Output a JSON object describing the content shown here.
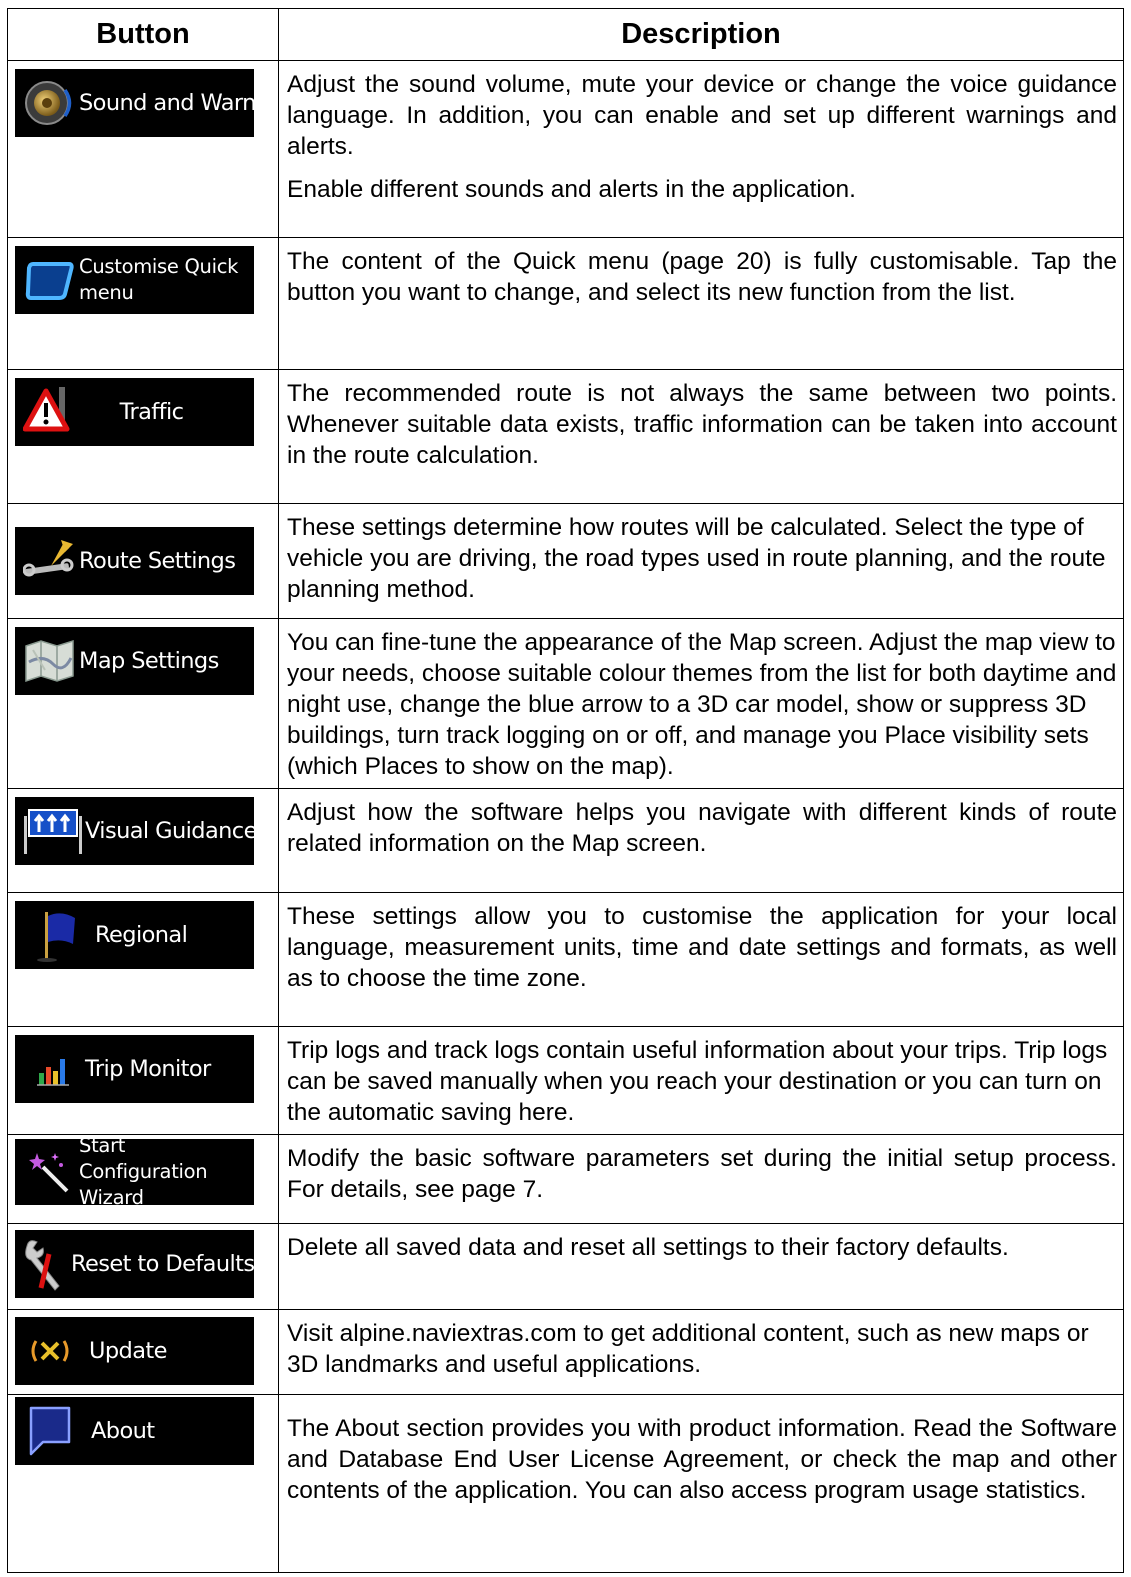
{
  "header": {
    "button": "Button",
    "description": "Description"
  },
  "rows": [
    {
      "label": "Sound and Warnings",
      "icon": "speaker-icon",
      "paragraphs": [
        "Adjust the sound volume, mute your device or change the voice guidance language. In addition, you can enable and set up different warnings and alerts.",
        "Enable different sounds and alerts in the application."
      ]
    },
    {
      "label": "Customise Quick menu",
      "icon": "quick-menu-icon",
      "paragraphs": [
        "The content of the Quick menu (page 20) is fully customisable. Tap the button you want to change, and select its new function from the list."
      ]
    },
    {
      "label": "Traffic",
      "icon": "traffic-warning-icon",
      "paragraphs": [
        "The recommended route is not always the same between two points. Whenever suitable data exists, traffic information can be taken into account in the route calculation."
      ]
    },
    {
      "label": "Route Settings",
      "icon": "route-settings-icon",
      "paragraphs": [
        "These settings determine how routes will be calculated. Select the type of vehicle you are driving, the road types used in route planning, and the route planning method."
      ]
    },
    {
      "label": "Map Settings",
      "icon": "map-icon",
      "paragraphs": [
        "You can fine-tune the appearance of the Map screen. Adjust the map view to your needs, choose suitable colour themes from the list for both daytime and night use, change the blue arrow to a 3D car model, show or suppress 3D buildings, turn track logging on or off, and manage you Place visibility sets (which Places to show on the map)."
      ]
    },
    {
      "label": "Visual Guidance",
      "icon": "lane-sign-icon",
      "paragraphs": [
        "Adjust how the software helps you navigate with different kinds of route related information on the Map screen."
      ]
    },
    {
      "label": "Regional",
      "icon": "flag-icon",
      "paragraphs": [
        "These settings allow you to customise the application for your local language, measurement units, time and date settings and formats, as well as to choose the time zone."
      ]
    },
    {
      "label": "Trip Monitor",
      "icon": "bar-chart-icon",
      "paragraphs": [
        "Trip logs and track logs contain useful information about your trips. Trip logs can be saved manually when you reach your destination or you can turn on the automatic saving here."
      ]
    },
    {
      "label": "Start Configuration Wizard",
      "icon": "magic-wand-icon",
      "paragraphs": [
        "Modify the basic software parameters set during the initial setup process. For details, see page 7."
      ]
    },
    {
      "label": "Reset to Defaults",
      "icon": "wrench-reset-icon",
      "paragraphs": [
        "Delete all saved data and reset all settings to their factory defaults."
      ]
    },
    {
      "label": "Update",
      "icon": "update-icon",
      "paragraphs": [
        "Visit alpine.naviextras.com to get additional content, such as new maps or 3D landmarks and useful applications."
      ]
    },
    {
      "label": "About",
      "icon": "about-icon",
      "paragraphs": [
        "The About section provides you with product information. Read the Software and Database End User License Agreement, or check the map and other contents of the application. You can also access program usage statistics."
      ]
    }
  ]
}
